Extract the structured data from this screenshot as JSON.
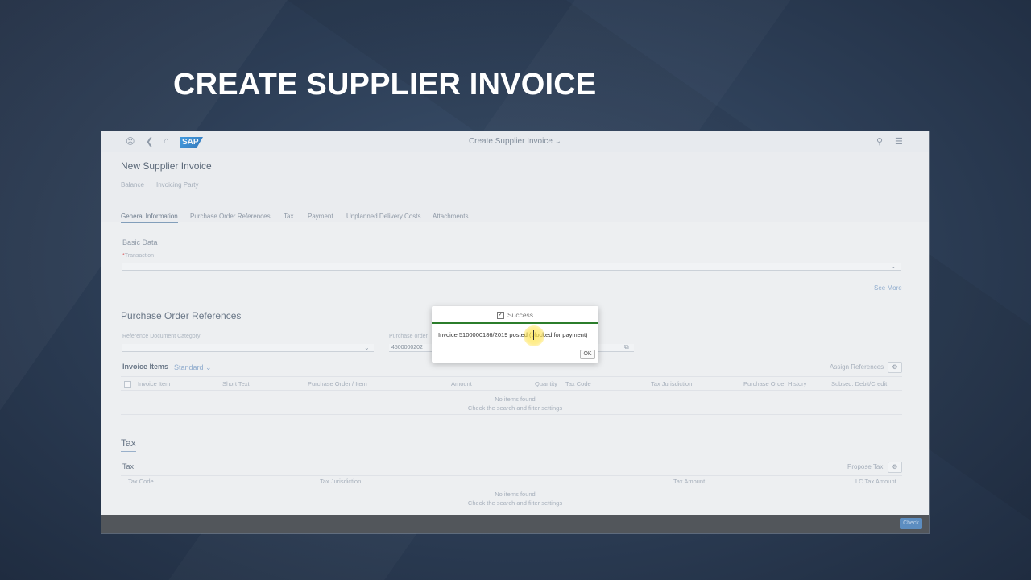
{
  "video_title": "CREATE SUPPLIER INVOICE",
  "shell": {
    "logo": "SAP",
    "title": "Create Supplier Invoice ⌄",
    "icons": [
      "user-icon",
      "back-icon",
      "home-icon",
      "search-icon",
      "menu-icon"
    ]
  },
  "header": {
    "title": "New Supplier Invoice",
    "attributes": [
      "Balance",
      "Invoicing Party"
    ]
  },
  "tabs": [
    "General Information",
    "Purchase Order References",
    "Tax",
    "Payment",
    "Unplanned Delivery Costs",
    "Attachments"
  ],
  "basic_data": {
    "title": "Basic Data",
    "transaction_label": "Transaction",
    "see_more": "See More"
  },
  "po_refs": {
    "title": "Purchase Order References",
    "ref_doc_category_label": "Reference Document Category",
    "purchase_order_label": "Purchase order",
    "purchase_order_value": "4500000202"
  },
  "invoice_items": {
    "title": "Invoice Items",
    "variant": "Standard ⌄",
    "assign_refs": "Assign References",
    "columns": [
      "Invoice Item",
      "Short Text",
      "Purchase Order / Item",
      "Amount",
      "Quantity",
      "Tax Code",
      "Tax Jurisdiction",
      "Purchase Order History",
      "Subseq. Debit/Credit"
    ],
    "no_items": "No items found",
    "no_items_hint": "Check the search and filter settings"
  },
  "tax": {
    "section_title": "Tax",
    "table_title": "Tax",
    "propose_tax": "Propose Tax",
    "columns": [
      "Tax Code",
      "Tax Jurisdiction",
      "Tax Amount",
      "LC Tax Amount"
    ],
    "no_items": "No items found",
    "no_items_hint": "Check the search and filter settings"
  },
  "footer": {
    "button": "Check"
  },
  "dialog": {
    "title": "Success",
    "message": "Invoice 5100000186/2019 posted (blocked for payment)",
    "ok": "OK",
    "accent_color": "#2b7d2b"
  }
}
